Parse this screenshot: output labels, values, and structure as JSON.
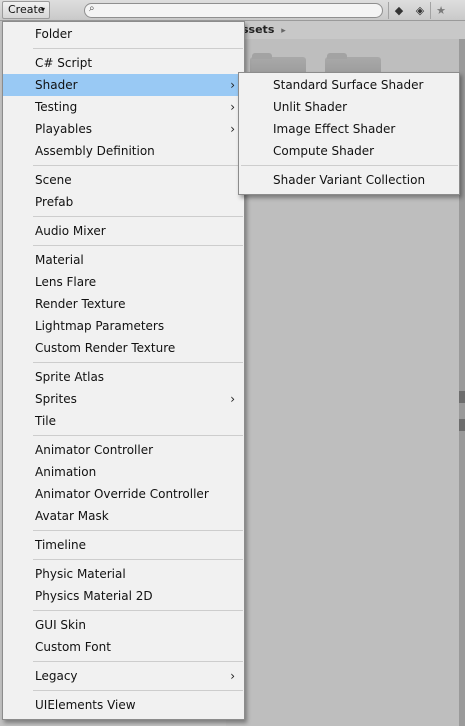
{
  "toolbar": {
    "create_label": "Create",
    "create_caret": "▾",
    "search_icon": "⌕",
    "icons": [
      {
        "name": "filter-by-type-icon",
        "glyph": "◆"
      },
      {
        "name": "label-icon",
        "glyph": "◈"
      },
      {
        "name": "favorite-star-icon",
        "glyph": "★"
      }
    ]
  },
  "breadcrumb": {
    "label": "ssets",
    "arrow": "▸"
  },
  "main_menu": {
    "groups": [
      [
        {
          "label": "Folder"
        }
      ],
      [
        {
          "label": "C# Script"
        },
        {
          "label": "Shader",
          "submenu": true,
          "highlighted": true
        },
        {
          "label": "Testing",
          "submenu": true
        },
        {
          "label": "Playables",
          "submenu": true
        },
        {
          "label": "Assembly Definition"
        }
      ],
      [
        {
          "label": "Scene"
        },
        {
          "label": "Prefab"
        }
      ],
      [
        {
          "label": "Audio Mixer"
        }
      ],
      [
        {
          "label": "Material"
        },
        {
          "label": "Lens Flare"
        },
        {
          "label": "Render Texture"
        },
        {
          "label": "Lightmap Parameters"
        },
        {
          "label": "Custom Render Texture"
        }
      ],
      [
        {
          "label": "Sprite Atlas"
        },
        {
          "label": "Sprites",
          "submenu": true
        },
        {
          "label": "Tile"
        }
      ],
      [
        {
          "label": "Animator Controller"
        },
        {
          "label": "Animation"
        },
        {
          "label": "Animator Override Controller"
        },
        {
          "label": "Avatar Mask"
        }
      ],
      [
        {
          "label": "Timeline"
        }
      ],
      [
        {
          "label": "Physic Material"
        },
        {
          "label": "Physics Material 2D"
        }
      ],
      [
        {
          "label": "GUI Skin"
        },
        {
          "label": "Custom Font"
        }
      ],
      [
        {
          "label": "Legacy",
          "submenu": true
        }
      ],
      [
        {
          "label": "UIElements View"
        }
      ]
    ]
  },
  "shader_submenu": {
    "groups": [
      [
        {
          "label": "Standard Surface Shader"
        },
        {
          "label": "Unlit Shader"
        },
        {
          "label": "Image Effect Shader"
        },
        {
          "label": "Compute Shader"
        }
      ],
      [
        {
          "label": "Shader Variant Collection"
        }
      ]
    ]
  },
  "submenu_chevron": "›",
  "colors": {
    "highlight": "#99c9f4",
    "menu_bg": "#f1f1f1",
    "panel_bg": "#c2c2c2"
  }
}
